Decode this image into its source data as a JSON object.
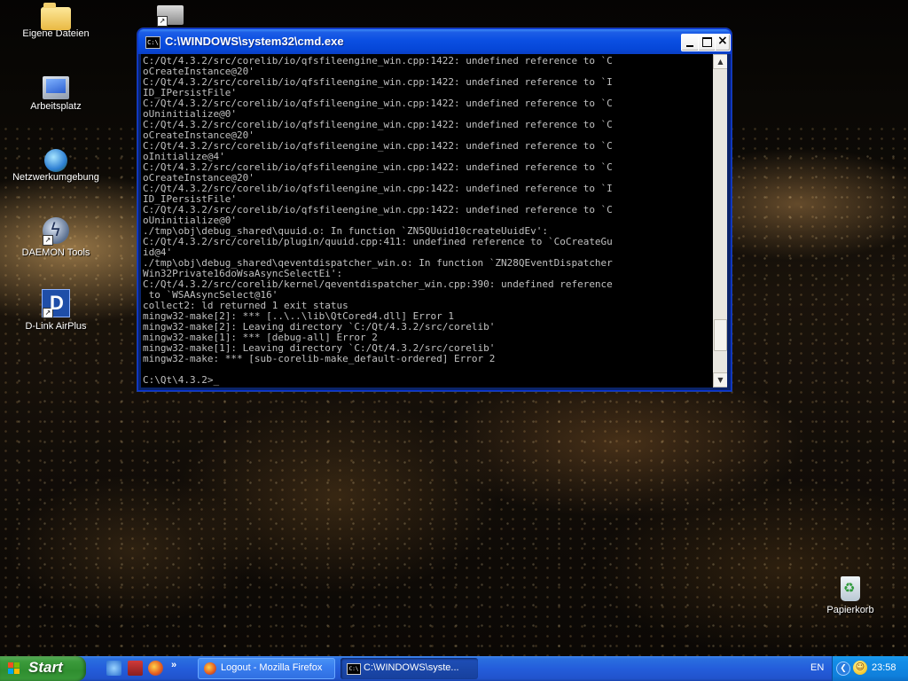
{
  "desktop": {
    "icons": [
      {
        "label": "Eigene Dateien",
        "icon": "folder-icon"
      },
      {
        "label": "Arbeitsplatz",
        "icon": "my-computer-icon"
      },
      {
        "label": "Netzwerkumgebung",
        "icon": "network-icon"
      },
      {
        "label": "DAEMON Tools",
        "icon": "daemon-tools-icon"
      },
      {
        "label": "D-Link AirPlus",
        "icon": "dlink-icon"
      },
      {
        "label": "",
        "icon": "printer-shortcut-icon"
      },
      {
        "label": "Papierkorb",
        "icon": "recycle-bin-icon"
      }
    ]
  },
  "cmd_window": {
    "title": "C:\\WINDOWS\\system32\\cmd.exe",
    "title_icon_text": "C:\\",
    "lines": [
      "C:/Qt/4.3.2/src/corelib/io/qfsfileengine_win.cpp:1422: undefined reference to `C",
      "oCreateInstance@20'",
      "C:/Qt/4.3.2/src/corelib/io/qfsfileengine_win.cpp:1422: undefined reference to `I",
      "ID_IPersistFile'",
      "C:/Qt/4.3.2/src/corelib/io/qfsfileengine_win.cpp:1422: undefined reference to `C",
      "oUninitialize@0'",
      "C:/Qt/4.3.2/src/corelib/io/qfsfileengine_win.cpp:1422: undefined reference to `C",
      "oCreateInstance@20'",
      "C:/Qt/4.3.2/src/corelib/io/qfsfileengine_win.cpp:1422: undefined reference to `C",
      "oInitialize@4'",
      "C:/Qt/4.3.2/src/corelib/io/qfsfileengine_win.cpp:1422: undefined reference to `C",
      "oCreateInstance@20'",
      "C:/Qt/4.3.2/src/corelib/io/qfsfileengine_win.cpp:1422: undefined reference to `I",
      "ID_IPersistFile'",
      "C:/Qt/4.3.2/src/corelib/io/qfsfileengine_win.cpp:1422: undefined reference to `C",
      "oUninitialize@0'",
      "./tmp\\obj\\debug_shared\\quuid.o: In function `ZN5QUuid10createUuidEv':",
      "C:/Qt/4.3.2/src/corelib/plugin/quuid.cpp:411: undefined reference to `CoCreateGu",
      "id@4'",
      "./tmp\\obj\\debug_shared\\qeventdispatcher_win.o: In function `ZN28QEventDispatcher",
      "Win32Private16doWsaAsyncSelectEi':",
      "C:/Qt/4.3.2/src/corelib/kernel/qeventdispatcher_win.cpp:390: undefined reference",
      " to `WSAAsyncSelect@16'",
      "collect2: ld returned 1 exit status",
      "mingw32-make[2]: *** [..\\..\\lib\\QtCored4.dll] Error 1",
      "mingw32-make[2]: Leaving directory `C:/Qt/4.3.2/src/corelib'",
      "mingw32-make[1]: *** [debug-all] Error 2",
      "mingw32-make[1]: Leaving directory `C:/Qt/4.3.2/src/corelib'",
      "mingw32-make: *** [sub-corelib-make_default-ordered] Error 2",
      "",
      "C:\\Qt\\4.3.2>_"
    ],
    "scroll_position": 0.92
  },
  "taskbar": {
    "start_label": "Start",
    "quick_launch": [
      "internet-explorer-icon",
      "save-icon",
      "firefox-icon"
    ],
    "quick_launch_more": "»",
    "tasks": [
      {
        "label": "Logout - Mozilla Firefox",
        "icon": "firefox-icon",
        "active": false
      },
      {
        "label": "C:\\WINDOWS\\syste...",
        "icon": "cmd-icon",
        "active": true
      }
    ],
    "language": "EN",
    "clock": "23:58"
  },
  "colors": {
    "titlebar": "#0b4fe2",
    "taskbar": "#245ddb",
    "start_button": "#3c9b3c",
    "console_bg": "#000000",
    "console_fg": "#c0c0c0"
  }
}
